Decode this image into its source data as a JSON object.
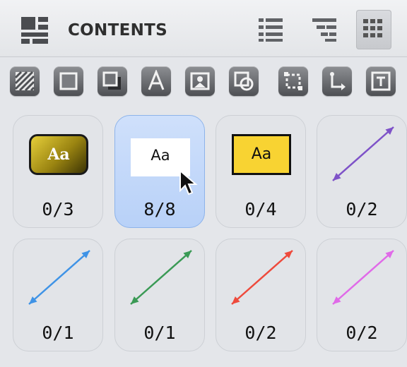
{
  "header": {
    "title": "CONTENTS",
    "view_buttons": [
      {
        "name": "list-view",
        "icon": "list-icon"
      },
      {
        "name": "outline-view",
        "icon": "hierarchy-icon"
      },
      {
        "name": "grid-view",
        "icon": "grid-icon",
        "active": true
      }
    ]
  },
  "toolbar": {
    "tools": [
      {
        "icon": "fill-pattern-icon"
      },
      {
        "icon": "square-stroke-icon"
      },
      {
        "icon": "shadow-box-icon"
      },
      {
        "icon": "font-style-icon"
      },
      {
        "icon": "image-icon"
      },
      {
        "icon": "shape-overlap-icon"
      },
      {
        "icon": "transform-icon"
      },
      {
        "icon": "connector-icon"
      },
      {
        "icon": "text-frame-icon"
      }
    ]
  },
  "styles": [
    {
      "kind": "text-gold",
      "sample": "Aa",
      "count": "0/3"
    },
    {
      "kind": "text-white",
      "sample": "Aa",
      "count": "8/8",
      "selected": true
    },
    {
      "kind": "text-yellow",
      "sample": "Aa",
      "count": "0/4"
    },
    {
      "kind": "line",
      "color": "#7e52c8",
      "count": "0/2"
    },
    {
      "kind": "line",
      "color": "#3f93e6",
      "count": "0/1"
    },
    {
      "kind": "line",
      "color": "#3a9a55",
      "count": "0/1"
    },
    {
      "kind": "line",
      "color": "#ee4a3c",
      "count": "0/2"
    },
    {
      "kind": "line",
      "color": "#e06ae8",
      "count": "0/2"
    }
  ]
}
